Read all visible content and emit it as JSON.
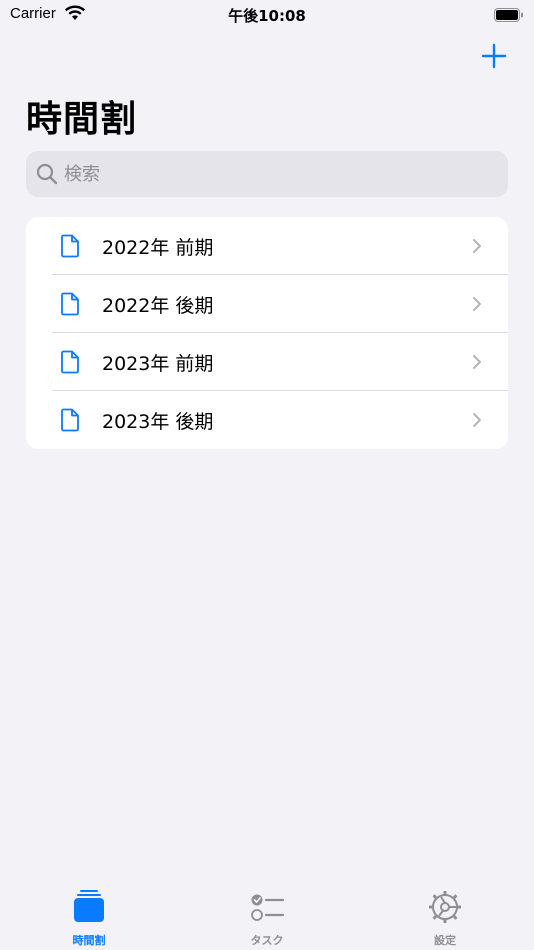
{
  "status_bar": {
    "carrier": "Carrier",
    "time": "午後10:08"
  },
  "header": {
    "title": "時間割",
    "add_icon": "plus-icon"
  },
  "search": {
    "placeholder": "検索",
    "value": ""
  },
  "timetables": [
    {
      "label": "2022年 前期"
    },
    {
      "label": "2022年 後期"
    },
    {
      "label": "2023年 前期"
    },
    {
      "label": "2023年 後期"
    }
  ],
  "tabbar": {
    "tabs": [
      {
        "label": "時間割",
        "icon": "timetable-icon",
        "selected": true
      },
      {
        "label": "タスク",
        "icon": "task-list-icon",
        "selected": false
      },
      {
        "label": "設定",
        "icon": "gear-icon",
        "selected": false
      }
    ]
  },
  "colors": {
    "accent": "#0a7aff",
    "inactive": "#8e8e93",
    "background": "#f2f2f7"
  }
}
